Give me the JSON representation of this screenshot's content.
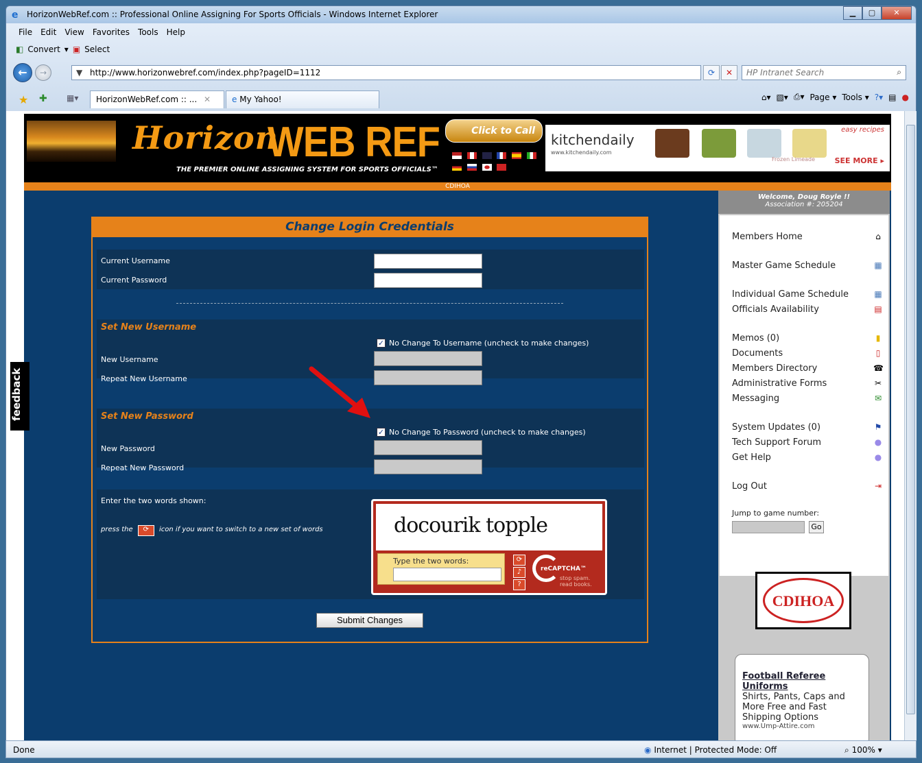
{
  "window": {
    "title": "HorizonWebRef.com :: Professional Online Assigning For Sports Officials - Windows Internet Explorer"
  },
  "menubar": [
    "File",
    "Edit",
    "View",
    "Favorites",
    "Tools",
    "Help"
  ],
  "cmdbar": {
    "convert": "Convert",
    "select": "Select"
  },
  "address": {
    "url": "http://www.horizonwebref.com/index.php?pageID=1112",
    "search_placeholder": "HP Intranet Search"
  },
  "tabs": [
    {
      "label": "HorizonWebRef.com :: ..."
    },
    {
      "label": "My Yahoo!"
    }
  ],
  "toolbar_right": {
    "page": "Page ▾",
    "tools": "Tools ▾"
  },
  "banner": {
    "logo_script": "Horizon",
    "logo_block": "WEB REF",
    "tagline": "THE PREMIER ONLINE ASSIGNING SYSTEM FOR SPORTS OFFICIALS™",
    "click_to_call": "Click to Call",
    "association_code": "CDIHOA"
  },
  "ad": {
    "brand": "kitchendaily",
    "url": "www.kitchendaily.com",
    "easy": "easy recipes",
    "frozen": "Frozen Limeade",
    "see_more": "SEE MORE ▸"
  },
  "form": {
    "title": "Change Login Credentials",
    "current_username_label": "Current Username",
    "current_password_label": "Current Password",
    "set_username_heading": "Set New Username",
    "no_change_username": "No Change To Username (uncheck to make changes)",
    "new_username_label": "New Username",
    "repeat_username_label": "Repeat New Username",
    "set_password_heading": "Set New Password",
    "no_change_password": "No Change To Password (uncheck to make changes)",
    "new_password_label": "New Password",
    "repeat_password_label": "Repeat New Password",
    "captcha_prompt": "Enter the two words shown:",
    "captcha_hint_before": "press the",
    "captcha_hint_after": "icon if you want to switch to a new set of words",
    "captcha_words": "docourik topple",
    "captcha_type_label": "Type the two words:",
    "recaptcha_brand": "reCAPTCHA™",
    "recaptcha_slogan": "stop spam. read books.",
    "submit": "Submit Changes"
  },
  "sidebar": {
    "welcome": "Welcome, Doug Royle !!",
    "association": "Association #: 205204",
    "items": [
      "Members Home",
      "Master Game Schedule",
      "Individual Game Schedule",
      "Officials Availability",
      "Memos (0)",
      "Documents",
      "Members Directory",
      "Administrative Forms",
      "Messaging",
      "System Updates (0)",
      "Tech Support Forum",
      "Get Help",
      "Log Out"
    ],
    "jump_label": "Jump to game number:",
    "go": "Go",
    "logo_text": "CDIHOA",
    "ad_title": "Football Referee Uniforms",
    "ad_body": "Shirts, Pants, Caps and More Free and Fast Shipping Options",
    "ad_url": "www.Ump-Attire.com"
  },
  "feedback": "feedback",
  "status": {
    "left": "Done",
    "zone": "Internet | Protected Mode: Off",
    "zoom": "100%"
  }
}
